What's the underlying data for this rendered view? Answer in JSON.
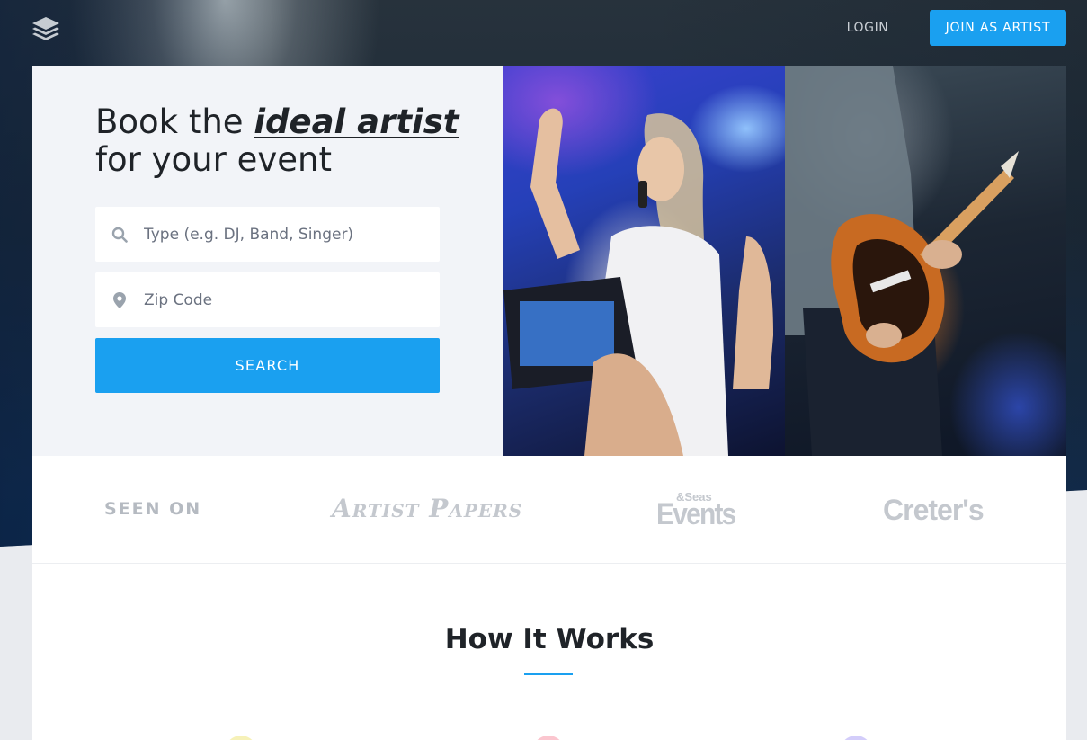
{
  "header": {
    "logo_icon": "layers-icon",
    "login_label": "LOGIN",
    "join_label": "JOIN AS ARTIST"
  },
  "hero": {
    "headline_prefix": "Book the ",
    "headline_emphasis": "ideal artist",
    "headline_suffix": "for your event",
    "type_field": {
      "placeholder": "Type (e.g. DJ, Band, Singer)",
      "value": "",
      "icon": "search-icon"
    },
    "zip_field": {
      "placeholder": "Zip Code",
      "value": "",
      "icon": "map-pin-icon"
    },
    "search_label": "SEARCH"
  },
  "seen_on": {
    "label": "SEEN ON",
    "brands": {
      "artist_papers": "Artist Papers",
      "events_top": "&Seas",
      "events": "Events",
      "creters": "Creter's"
    }
  },
  "how_it_works": {
    "title": "How It Works"
  },
  "colors": {
    "accent": "#1aa0f0",
    "panel_bg": "#f2f4f8",
    "text_dark": "#1f2328",
    "brand_gray": "#c4c8ce"
  }
}
